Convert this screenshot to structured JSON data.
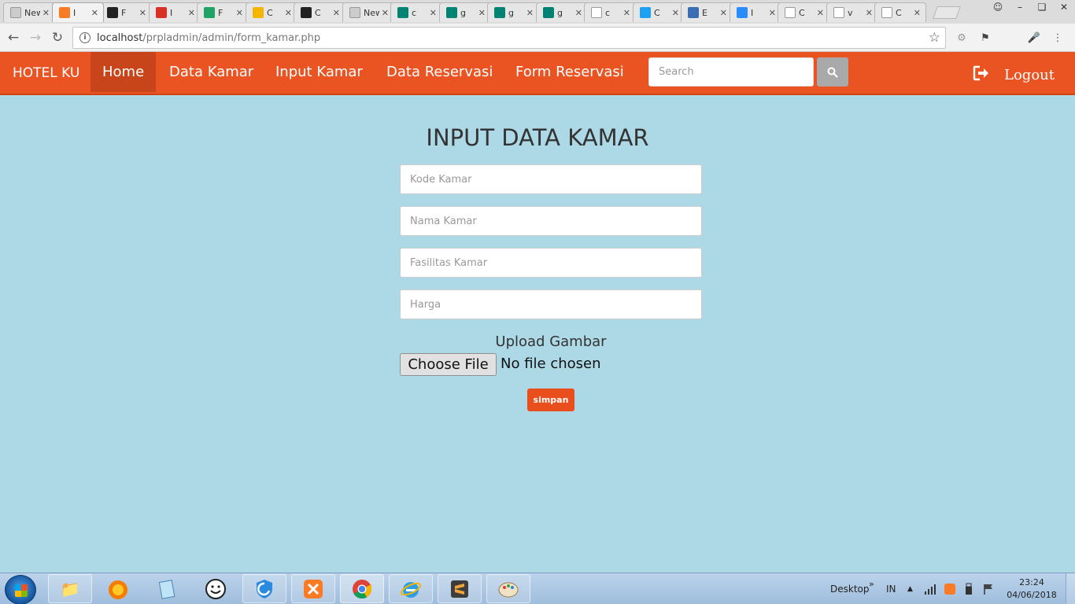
{
  "browser": {
    "tabs": [
      {
        "title": "New",
        "icon": "blank-icon",
        "color": "#cccccc"
      },
      {
        "title": "I",
        "icon": "xampp-icon",
        "color": "#fb7a24",
        "active": true
      },
      {
        "title": "F",
        "icon": "github-icon",
        "color": "#222222"
      },
      {
        "title": "I",
        "icon": "gmail-icon",
        "color": "#d93025"
      },
      {
        "title": "F",
        "icon": "drive-icon",
        "color": "#1fa463"
      },
      {
        "title": "C",
        "icon": "classroom-icon",
        "color": "#f4b400"
      },
      {
        "title": "C",
        "icon": "github-icon",
        "color": "#222222"
      },
      {
        "title": "New",
        "icon": "blank-icon",
        "color": "#cccccc"
      },
      {
        "title": "c",
        "icon": "bing-icon",
        "color": "#008373"
      },
      {
        "title": "g",
        "icon": "bing-icon",
        "color": "#008373"
      },
      {
        "title": "g",
        "icon": "bing-icon",
        "color": "#008373"
      },
      {
        "title": "g",
        "icon": "bing-icon",
        "color": "#008373"
      },
      {
        "title": "c",
        "icon": "page-icon",
        "color": "#ffffff"
      },
      {
        "title": "C",
        "icon": "bird-icon",
        "color": "#1da1f2"
      },
      {
        "title": "E",
        "icon": "di-icon",
        "color": "#3b6db3"
      },
      {
        "title": "I",
        "icon": "circle-icon",
        "color": "#2a8cff"
      },
      {
        "title": "C",
        "icon": "page-icon",
        "color": "#ffffff"
      },
      {
        "title": "v",
        "icon": "page-icon",
        "color": "#ffffff"
      },
      {
        "title": "C",
        "icon": "p-icon",
        "color": "#ffffff"
      }
    ],
    "url_host": "localhost",
    "url_path": "/prpladmin/admin/form_kamar.php"
  },
  "navbar": {
    "brand": "HOTEL KU",
    "links": [
      "Home",
      "Data Kamar",
      "Input Kamar",
      "Data Reservasi",
      "Form Reservasi"
    ],
    "active_link": "Home",
    "search_placeholder": "Search",
    "logout_label": "Logout",
    "accent_color": "#ea5422"
  },
  "form": {
    "title": "INPUT DATA KAMAR",
    "fields": [
      {
        "placeholder": "Kode Kamar",
        "value": ""
      },
      {
        "placeholder": "Nama Kamar",
        "value": ""
      },
      {
        "placeholder": "Fasilitas Kamar",
        "value": ""
      },
      {
        "placeholder": "Harga",
        "value": ""
      }
    ],
    "upload_label": "Upload Gambar",
    "file_button": "Choose File",
    "file_status": "No file chosen",
    "submit_label": "simpan"
  },
  "taskbar": {
    "apps": [
      "file-explorer-icon",
      "firefox-icon",
      "notepad-icon",
      "smiley-icon",
      "shield-icon",
      "xampp-icon",
      "chrome-icon",
      "ie-icon",
      "sublime-icon",
      "paint-icon"
    ],
    "desktop_label": "Desktop",
    "lang": "IN",
    "time": "23:24",
    "date": "04/06/2018"
  }
}
